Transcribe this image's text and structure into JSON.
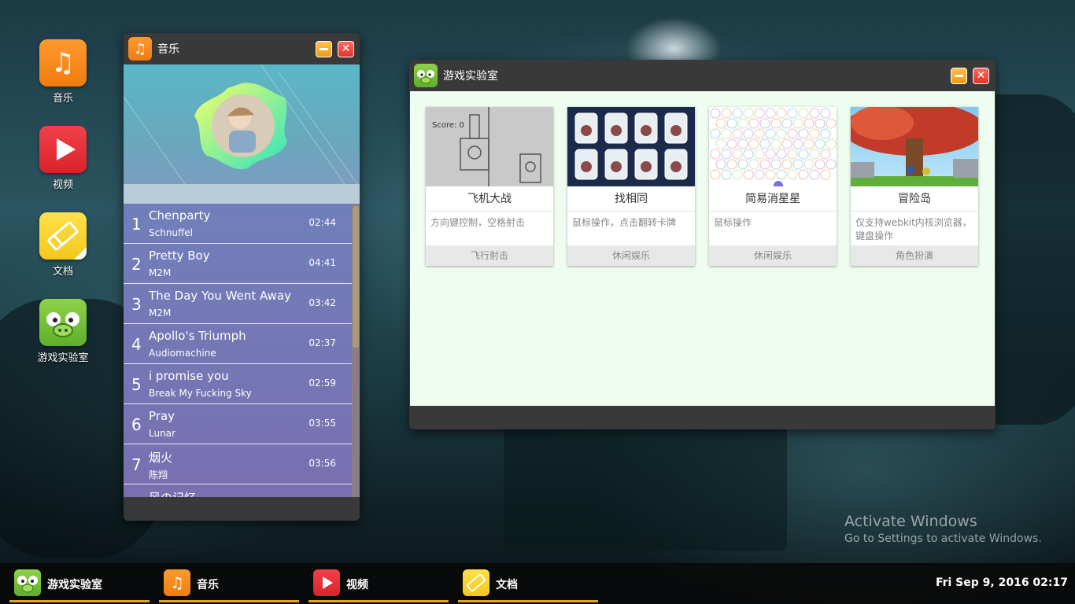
{
  "desktop": {
    "icons": [
      {
        "label": "音乐",
        "icon": "music-note-icon"
      },
      {
        "label": "视频",
        "icon": "play-icon"
      },
      {
        "label": "文档",
        "icon": "eraser-icon"
      },
      {
        "label": "游戏实验室",
        "icon": "green-pig-icon"
      }
    ]
  },
  "music_window": {
    "title": "音乐",
    "songs": [
      {
        "num": "1",
        "name": "Chenparty",
        "artist": "Schnuffel",
        "duration": "02:44"
      },
      {
        "num": "2",
        "name": "Pretty Boy",
        "artist": "M2M",
        "duration": "04:41"
      },
      {
        "num": "3",
        "name": "The Day You Went Away",
        "artist": "M2M",
        "duration": "03:42"
      },
      {
        "num": "4",
        "name": "Apollo's Triumph",
        "artist": "Audiomachine",
        "duration": "02:37"
      },
      {
        "num": "5",
        "name": "i promise you",
        "artist": "Break My Fucking Sky",
        "duration": "02:59"
      },
      {
        "num": "6",
        "name": "Pray",
        "artist": "Lunar",
        "duration": "03:55"
      },
      {
        "num": "7",
        "name": "烟火",
        "artist": "陈翔",
        "duration": "03:56"
      },
      {
        "num": "8",
        "name": "风の记忆",
        "artist": "",
        "duration": ""
      }
    ]
  },
  "game_window": {
    "title": "游戏实验室",
    "games": [
      {
        "name": "飞机大战",
        "desc": "方向键控制，空格射击",
        "category": "飞行射击"
      },
      {
        "name": "找相同",
        "desc": "鼠标操作，点击翻转卡牌",
        "category": "休闲娱乐"
      },
      {
        "name": "简易消星星",
        "desc": "鼠标操作",
        "category": "休闲娱乐"
      },
      {
        "name": "冒险岛",
        "desc": "仅支持webkit内核浏览器，键盘操作",
        "category": "角色扮演"
      }
    ]
  },
  "taskbar": {
    "items": [
      {
        "label": "游戏实验室",
        "icon": "green-pig-icon"
      },
      {
        "label": "音乐",
        "icon": "music-note-icon"
      },
      {
        "label": "视频",
        "icon": "play-icon"
      },
      {
        "label": "文档",
        "icon": "eraser-icon"
      }
    ],
    "clock": "Fri Sep 9, 2016 02:17"
  },
  "watermark": {
    "line1": "Activate Windows",
    "line2": "Go to Settings to activate Windows."
  },
  "colors": {
    "music_orange": "#f07c10",
    "video_red": "#e2322a",
    "doc_yellow": "#f2c81c",
    "game_green": "#5fae2c",
    "taskbar_underline": "#e9a21c"
  }
}
